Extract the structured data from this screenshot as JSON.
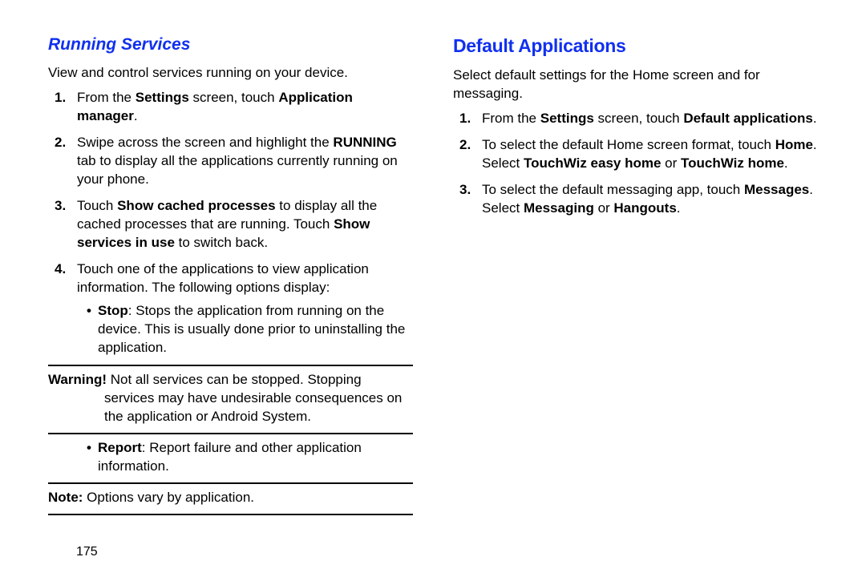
{
  "pageNumber": "175",
  "left": {
    "heading": "Running Services",
    "intro": "View and control services running on your device.",
    "step1": {
      "a": "From the ",
      "b": "Settings",
      "c": " screen, touch ",
      "d": "Application manager",
      "e": "."
    },
    "step2": {
      "a": "Swipe across the screen and highlight the ",
      "b": "RUNNING",
      "c": " tab to display all the applications currently running on your phone."
    },
    "step3": {
      "a": "Touch ",
      "b": "Show cached processes",
      "c": " to display all the cached processes that are running. Touch ",
      "d": "Show services in use",
      "e": " to switch back."
    },
    "step4": {
      "a": "Touch one of the applications to view application information. The following options display:"
    },
    "b_stop": {
      "b": "Stop",
      "a": ": Stops the application from running on the device. This is usually done prior to uninstalling the application."
    },
    "warn": {
      "b": "Warning!",
      "a": " Not all services can be stopped. Stopping services may have undesirable consequences on the application or Android System."
    },
    "b_report": {
      "b": "Report",
      "a": ": Report failure and other application information."
    },
    "note": {
      "b": "Note:",
      "a": " Options vary by application."
    }
  },
  "right": {
    "heading": "Default Applications",
    "intro": "Select default settings for the Home screen and for messaging.",
    "step1": {
      "a": "From the ",
      "b": "Settings",
      "c": " screen, touch ",
      "d": "Default applications",
      "e": "."
    },
    "step2": {
      "a": "To select the default Home screen format, touch ",
      "b": "Home",
      "c": ". Select ",
      "d": "TouchWiz easy home",
      "e": " or ",
      "f": "TouchWiz home",
      "g": "."
    },
    "step3": {
      "a": "To select the default messaging app, touch ",
      "b": "Messages",
      "c": ". Select ",
      "d": "Messaging",
      "e": " or ",
      "f": "Hangouts",
      "g": "."
    }
  }
}
